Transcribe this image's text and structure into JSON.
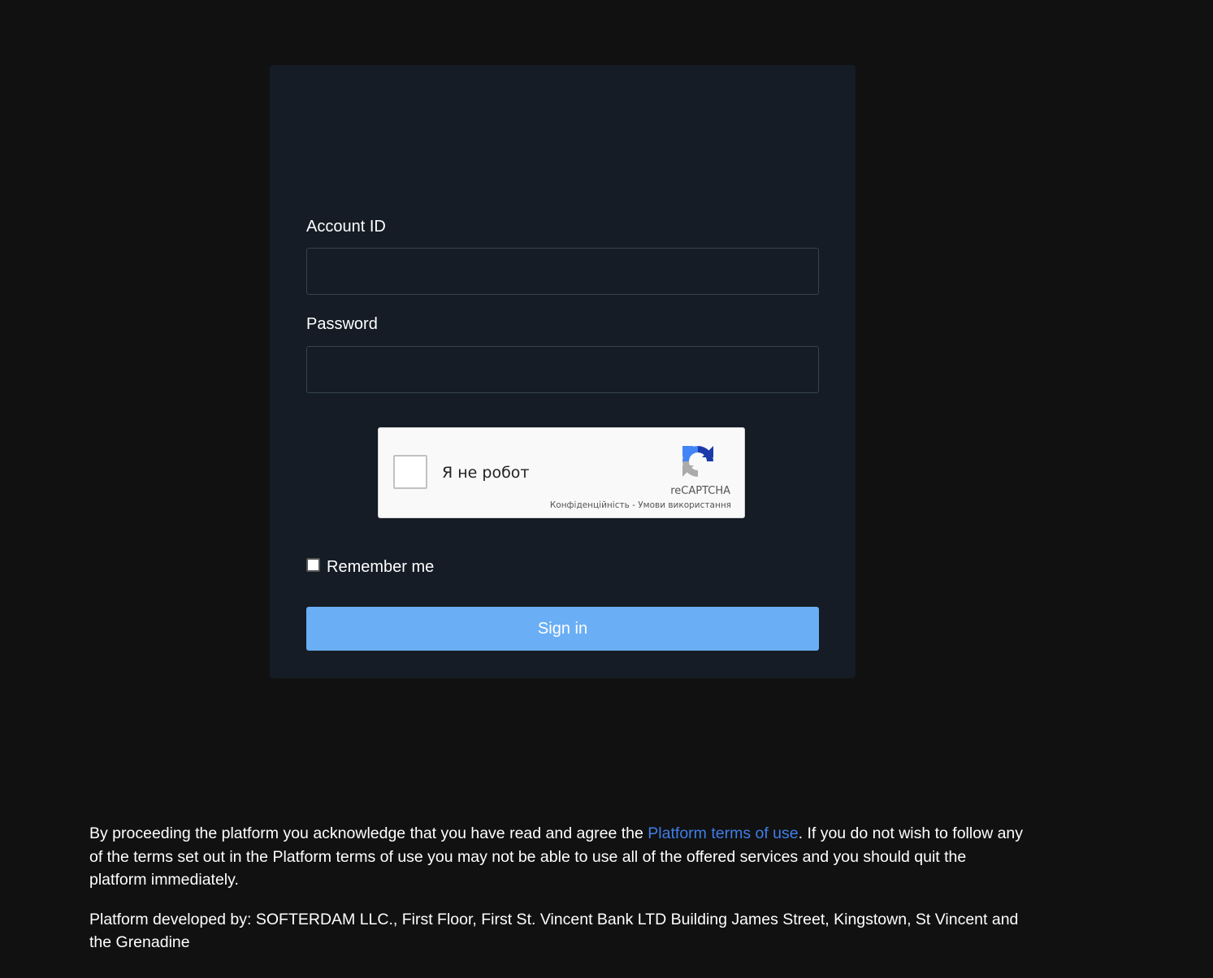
{
  "login": {
    "account_label": "Account ID",
    "account_value": "",
    "password_label": "Password",
    "password_value": "",
    "remember_label": "Remember me",
    "remember_checked": false,
    "signin_label": "Sign in"
  },
  "recaptcha": {
    "label": "Я не робот",
    "brand": "reCAPTCHA",
    "privacy_link": "Конфіденційність",
    "separator": " - ",
    "terms_link": "Умови використання"
  },
  "footer": {
    "text_before_link": "By proceeding the platform you acknowledge that you have read and agree the ",
    "terms_link": "Platform terms of use",
    "text_after_link": ". If you do not wish to follow any of the terms set out in the Platform terms of use you may not be able to use all of the offered services and you should quit the platform immediately.",
    "developer": "Platform developed by: SOFTERDAM LLC., First Floor, First St. Vincent Bank LTD Building James Street, Kingstown, St Vincent and the Grenadine"
  },
  "colors": {
    "background": "#111111",
    "card": "#151c25",
    "button": "#6aaef5",
    "link": "#3f7ee8"
  }
}
